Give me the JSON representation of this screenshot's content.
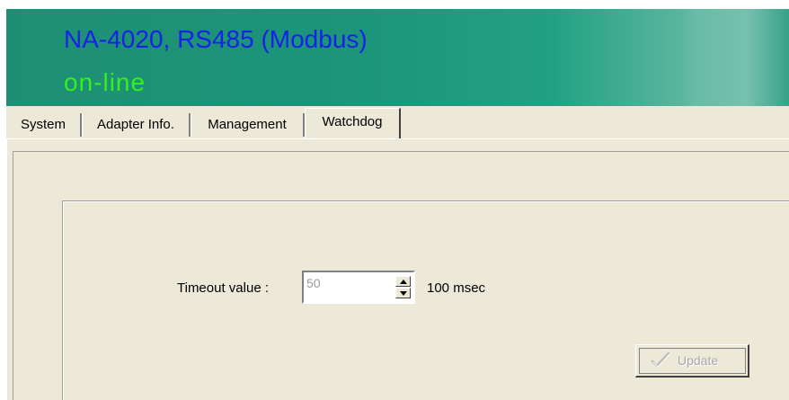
{
  "header": {
    "title": "NA-4020, RS485 (Modbus)",
    "status": "on-line",
    "title_color": "#1622e8",
    "status_color": "#36ef1c",
    "background_color": "#1e8f74"
  },
  "tabs": [
    {
      "label": "System",
      "active": false
    },
    {
      "label": "Adapter Info.",
      "active": false
    },
    {
      "label": "Management",
      "active": false
    },
    {
      "label": "Watchdog",
      "active": true
    }
  ],
  "watchdog": {
    "timeout_label": "Timeout value :",
    "timeout_value": "50",
    "unit": "100 msec",
    "update_label": "Update",
    "update_icon": "check-pencil-icon",
    "update_enabled": false
  }
}
